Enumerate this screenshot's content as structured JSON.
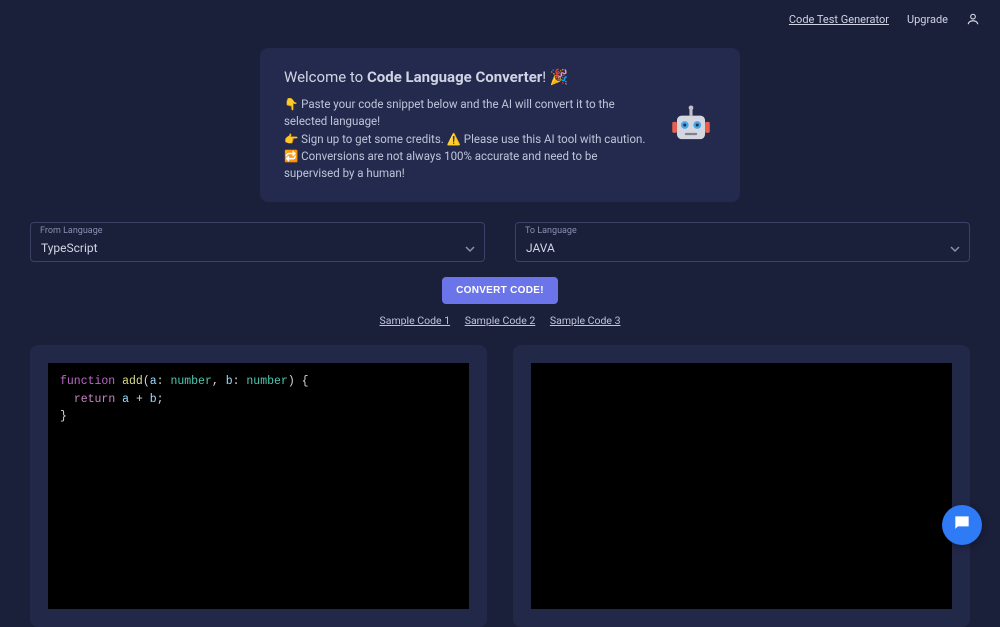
{
  "header": {
    "codeTestGen": "Code Test Generator",
    "upgrade": "Upgrade"
  },
  "welcome": {
    "titlePrefix": "Welcome to ",
    "titleBold": "Code Language Converter",
    "titleSuffix": "! 🎉",
    "line1": "👇 Paste your code snippet below and the AI will convert it to the selected language!",
    "line2": "👉 Sign up to get some credits. ⚠️ Please use this AI tool with caution.",
    "line3": "🔁 Conversions are not always 100% accurate and need to be supervised by a human!"
  },
  "fromLang": {
    "label": "From Language",
    "value": "TypeScript"
  },
  "toLang": {
    "label": "To Language",
    "value": "JAVA"
  },
  "convertBtn": "CONVERT CODE!",
  "samples": {
    "s1": "Sample Code 1",
    "s2": "Sample Code 2",
    "s3": "Sample Code 3"
  },
  "code": {
    "kwFunc": "function",
    "fnName": " add",
    "open": "(",
    "p1": "a",
    "colon1": ": ",
    "t1": "number",
    "comma": ", ",
    "p2": "b",
    "colon2": ": ",
    "t2": "number",
    "closeSig": ") {",
    "indent": "  ",
    "kwRet": "return",
    "exprSp": " ",
    "v1": "a",
    "plus": " + ",
    "v2": "b",
    "semi": ";",
    "closeBrace": "}"
  }
}
